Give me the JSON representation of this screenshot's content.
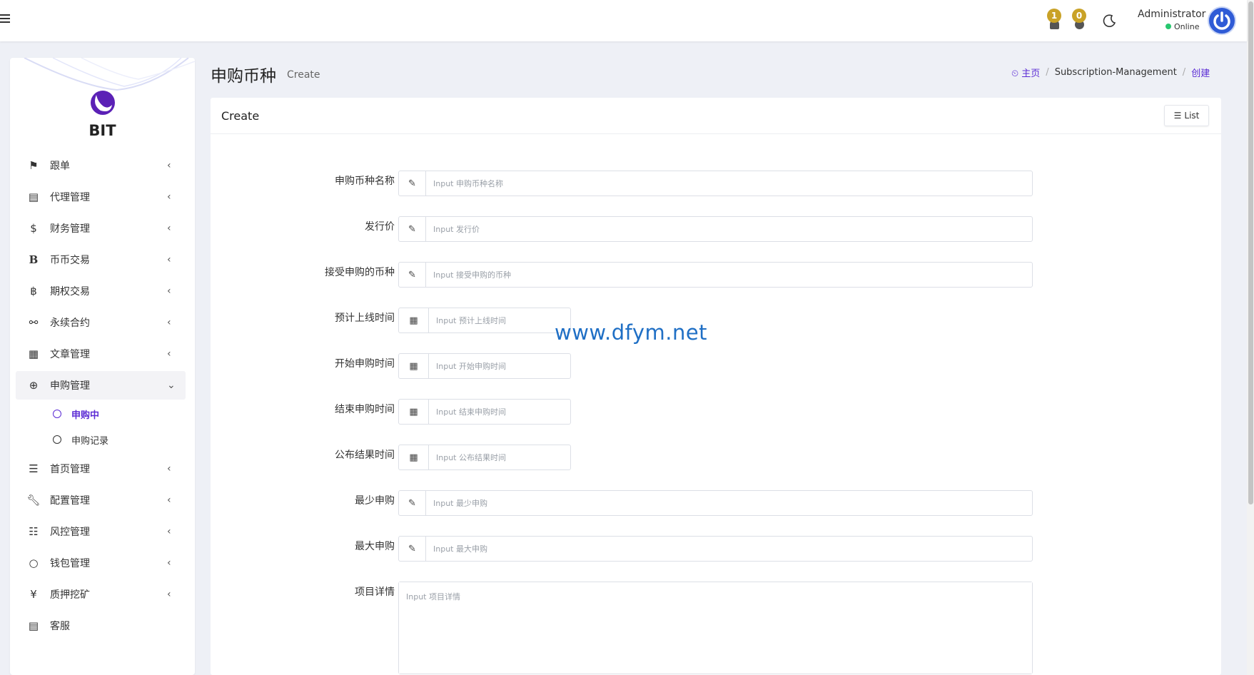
{
  "header": {
    "notifications": [
      {
        "count": "1"
      },
      {
        "count": "0"
      }
    ],
    "user": {
      "name": "Administrator",
      "status": "Online"
    }
  },
  "sidebar": {
    "brand": "BIT",
    "items": [
      {
        "label": "跟单",
        "icon": "flag-icon"
      },
      {
        "label": "代理管理",
        "icon": "id-card-icon"
      },
      {
        "label": "财务管理",
        "icon": "dollar-icon"
      },
      {
        "label": "币币交易",
        "icon": "bold-b-icon"
      },
      {
        "label": "期权交易",
        "icon": "bitcoin-icon"
      },
      {
        "label": "永续合约",
        "icon": "link-icon"
      },
      {
        "label": "文章管理",
        "icon": "newspaper-icon"
      },
      {
        "label": "申购管理",
        "icon": "life-ring-icon"
      },
      {
        "label": "首页管理",
        "icon": "bars-icon"
      },
      {
        "label": "配置管理",
        "icon": "wrench-icon"
      },
      {
        "label": "风控管理",
        "icon": "list-indent-icon"
      },
      {
        "label": "钱包管理",
        "icon": "circle-icon"
      },
      {
        "label": "质押挖矿",
        "icon": "yen-icon"
      },
      {
        "label": "客服",
        "icon": "id-card-icon"
      }
    ],
    "subitems": [
      {
        "label": "申购中"
      },
      {
        "label": "申购记录"
      }
    ]
  },
  "page": {
    "title": "申购币种",
    "subtitle": "Create",
    "breadcrumb": {
      "home": "主页",
      "middle": "Subscription-Management",
      "current": "创建"
    }
  },
  "card": {
    "title": "Create",
    "list_button": "List"
  },
  "form": {
    "fields": [
      {
        "label": "申购币种名称",
        "placeholder": "Input 申购币种名称",
        "kind": "text"
      },
      {
        "label": "发行价",
        "placeholder": "Input 发行价",
        "kind": "text"
      },
      {
        "label": "接受申购的币种",
        "placeholder": "Input 接受申购的币种",
        "kind": "text"
      },
      {
        "label": "预计上线时间",
        "placeholder": "Input 预计上线时间",
        "kind": "date"
      },
      {
        "label": "开始申购时间",
        "placeholder": "Input 开始申购时间",
        "kind": "date"
      },
      {
        "label": "结束申购时间",
        "placeholder": "Input 结束申购时间",
        "kind": "date"
      },
      {
        "label": "公布结果时间",
        "placeholder": "Input 公布结果时间",
        "kind": "date"
      },
      {
        "label": "最少申购",
        "placeholder": "Input 最少申购",
        "kind": "text"
      },
      {
        "label": "最大申购",
        "placeholder": "Input 最大申购",
        "kind": "text"
      },
      {
        "label": "项目详情",
        "placeholder": "Input 项目详情",
        "kind": "textarea"
      }
    ]
  },
  "watermark": "www.dfym.net",
  "colors": {
    "accent": "#5b2bd4",
    "badge": "#c9a227",
    "online": "#28c76f",
    "avatar": "#2f5bd6"
  }
}
